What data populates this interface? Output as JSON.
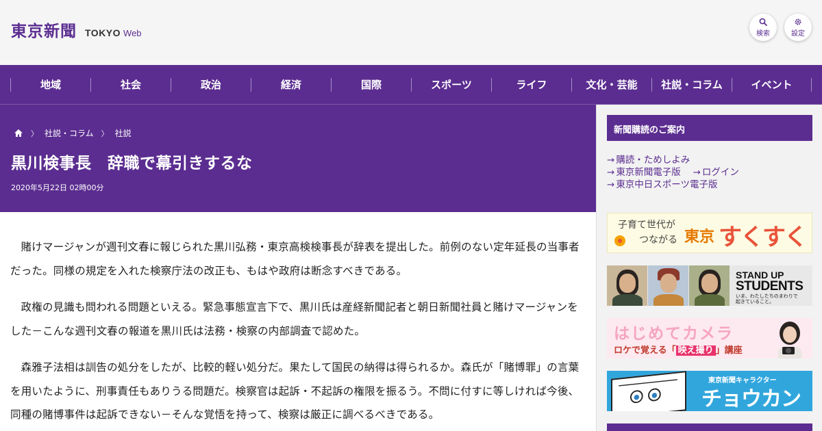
{
  "header": {
    "logo_jp": "東京新聞",
    "logo_en": "TOKYO",
    "logo_web": "Web",
    "search_label": "検索",
    "settings_label": "設定"
  },
  "nav": {
    "items": [
      "地域",
      "社会",
      "政治",
      "経済",
      "国際",
      "スポーツ",
      "ライフ",
      "文化・芸能",
      "社説・コラム",
      "イベント"
    ]
  },
  "breadcrumb": {
    "home_icon": "home-icon",
    "items": [
      "社説・コラム",
      "社説"
    ]
  },
  "article": {
    "title": "黒川検事長　辞職で幕引きするな",
    "date": "2020年5月22日 02時00分",
    "paragraphs": [
      "賭けマージャンが週刊文春に報じられた黒川弘務・東京高検検事長が辞表を提出した。前例のない定年延長の当事者だった。同様の規定を入れた検察庁法の改正も、もはや政府は断念すべきである。",
      "政権の見識も問われる問題といえる。緊急事態宣言下で、黒川氏は産経新聞記者と朝日新聞社員と賭けマージャンをした－こんな週刊文春の報道を黒川氏は法務・検察の内部調査で認めた。",
      "森雅子法相は訓告の処分をしたが、比較的軽い処分だ。果たして国民の納得は得られるか。森氏が「賭博罪」の言葉を用いたように、刑事責任もありうる問題だ。検察官は起訴・不起訴の権限を振るう。不問に付すに等しければ今後、同種の賭博事件は起訴できない－そんな覚悟を持って、検察は厳正に調べるべきである。"
    ]
  },
  "sidebar": {
    "subscription_heading": "新聞購読のご案内",
    "links": {
      "subscribe": "購読・ためしよみ",
      "digital": "東京新聞電子版",
      "login": "ログイン",
      "chunichi_sports": "東京中日スポーツ電子版"
    },
    "banners": {
      "sukusuku": {
        "line1": "子育て世代が",
        "line2": "つながる",
        "brand": "東京",
        "name": "すくすく"
      },
      "standup": {
        "line1": "STAND UP",
        "line2": "STUDENTS",
        "line3": "いま、わたしたちのまわりで",
        "line4": "起きていること。"
      },
      "camera": {
        "title": "はじめてカメラ",
        "sub_pre": "ロケで覚える「",
        "sub_highlight": "映え撮り",
        "sub_post": "」講座"
      },
      "chokanzu": {
        "line1": "東京新聞キャラクター",
        "name": "チョウカンヌ"
      }
    }
  },
  "colors": {
    "brand_purple": "#5b2d90",
    "link_purple": "#5b2d90",
    "background": "#f4f4f4"
  }
}
